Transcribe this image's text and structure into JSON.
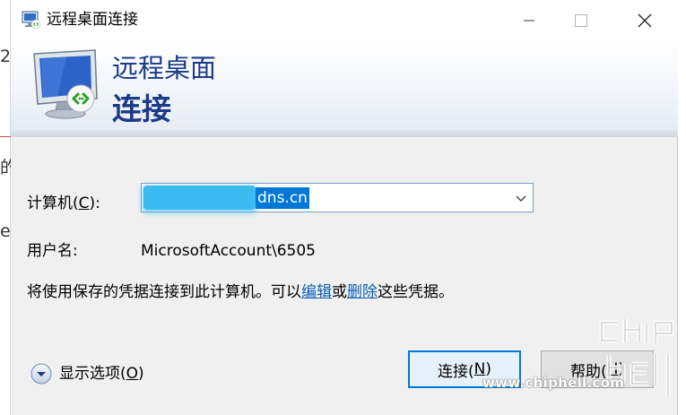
{
  "background": {
    "edge_chars": [
      "2",
      "的",
      "e"
    ]
  },
  "titlebar": {
    "title": "远程桌面连接",
    "minimize_icon": "minimize-icon",
    "maximize_icon": "maximize-icon",
    "close_icon": "close-icon"
  },
  "banner": {
    "line1": "远程桌面",
    "line2": "连接",
    "icon": "remote-desktop-monitor-icon"
  },
  "form": {
    "computer_label_prefix": "计算机(",
    "computer_label_key": "C",
    "computer_label_suffix": "):",
    "computer_value_visible": "dns.cn",
    "username_label": "用户名:",
    "username_value": "MicrosoftAccount\\6505"
  },
  "info": {
    "prefix": "将使用保存的凭据连接到此计算机。可以",
    "edit_link": "编辑",
    "or": "或",
    "delete_link": "删除",
    "suffix": "这些凭据。"
  },
  "options": {
    "label_prefix": "显示选项(",
    "label_key": "O",
    "label_suffix": ")"
  },
  "buttons": {
    "connect_prefix": "连接(",
    "connect_key": "N",
    "connect_suffix": ")",
    "help_prefix": "帮助(",
    "help_key": "H",
    "help_suffix": ")"
  },
  "watermark": {
    "url": "www.chiphell.com"
  },
  "colors": {
    "accent": "#0078d7",
    "banner_text": "#1b3a88",
    "link": "#0a5fb4",
    "redaction": "#3bbcf0"
  }
}
